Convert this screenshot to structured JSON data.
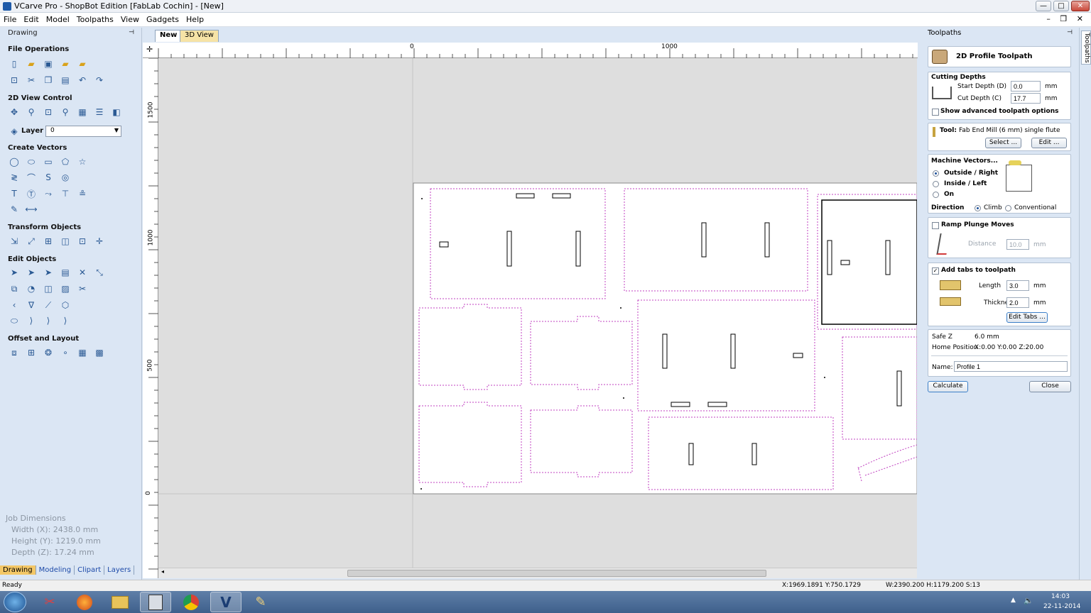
{
  "window": {
    "title": "VCarve Pro - ShopBot Edition [FabLab Cochin] - [New]",
    "min": "—",
    "max": "□",
    "close": "✕"
  },
  "menu": [
    "File",
    "Edit",
    "Model",
    "Toolpaths",
    "View",
    "Gadgets",
    "Help"
  ],
  "mdi_controls": "– ❐ ✕",
  "left_panel": {
    "title": "Drawing",
    "pin": "⊣",
    "sections": {
      "file_ops": "File Operations",
      "view_control": "2D View Control",
      "create_vectors": "Create Vectors",
      "transform": "Transform Objects",
      "edit_objects": "Edit Objects",
      "offset": "Offset and Layout"
    },
    "layer_label": "Layer",
    "layer_value": "0",
    "job_dimensions": {
      "title": "Job Dimensions",
      "width": "Width  (X): 2438.0 mm",
      "height": "Height (Y): 1219.0 mm",
      "depth": "Depth  (Z): 17.24 mm"
    },
    "bottom_tabs": [
      "Drawing",
      "Modeling",
      "Clipart",
      "Layers"
    ]
  },
  "doc_tabs": {
    "new": "New",
    "view3d": "3D View"
  },
  "ruler": {
    "top": [
      "0",
      "1000"
    ],
    "left": [
      "1500",
      "1000",
      "500",
      "0"
    ]
  },
  "toolpaths_panel": {
    "title": "Toolpaths",
    "pin": "⊣",
    "heading": "2D Profile Toolpath",
    "cutting_depths": "Cutting Depths",
    "start_depth_label": "Start Depth (D)",
    "start_depth": "0.0",
    "cut_depth_label": "Cut Depth (C)",
    "cut_depth": "17.7",
    "unit": "mm",
    "show_advanced": "Show advanced toolpath options",
    "tool_label": "Tool:",
    "tool_name": "Fab End Mill (6 mm) single flute",
    "select_btn": "Select ...",
    "edit_btn": "Edit ...",
    "machine_vectors": "Machine Vectors...",
    "outside": "Outside / Right",
    "inside": "Inside / Left",
    "on": "On",
    "direction_label": "Direction",
    "climb": "Climb",
    "conventional": "Conventional",
    "ramp": "Ramp Plunge Moves",
    "distance_label": "Distance",
    "distance": "10.0",
    "add_tabs": "Add tabs to toolpath",
    "length_label": "Length",
    "length": "3.0",
    "thickness_label": "Thickness",
    "thickness": "2.0",
    "edit_tabs_btn": "Edit Tabs ...",
    "safe_z_label": "Safe Z",
    "safe_z": "6.0 mm",
    "home_label": "Home Position",
    "home": "X:0.00 Y:0.00 Z:20.00",
    "name_label": "Name:",
    "name": "Profile 1",
    "calculate": "Calculate",
    "close": "Close"
  },
  "side_tab": "Toolpaths",
  "status": {
    "ready": "Ready",
    "coords": "X:1969.1891 Y:750.1729",
    "size": "W:2390.200  H:1179.200  S:13"
  },
  "taskbar": {
    "time": "14:03",
    "date": "22-11-2014"
  },
  "colors": {
    "accent": "#f3c767",
    "vector": "#c040c0",
    "panel": "#dbe6f4"
  }
}
